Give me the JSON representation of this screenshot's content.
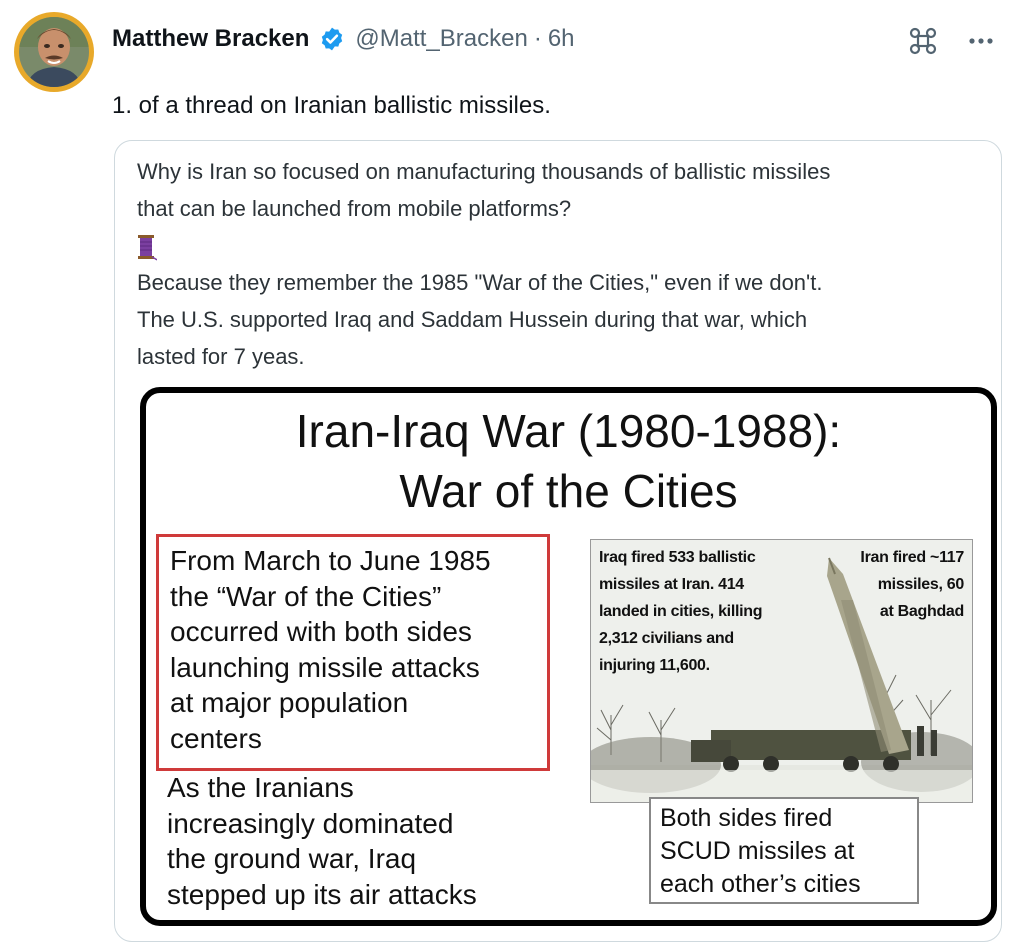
{
  "tweet": {
    "author_name": "Matthew Bracken",
    "handle": "@Matt_Bracken",
    "separator": "·",
    "time": "6h",
    "text": "1. of a thread on Iranian ballistic missiles.",
    "more_icon": "more-horizontal-icon",
    "cmd_icon": "command-icon"
  },
  "quote": {
    "para1_line1": "Why is Iran so focused on manufacturing thousands of ballistic missiles",
    "para1_line2": "that can be launched from mobile platforms?",
    "emoji": "thread-spool-emoji",
    "para2_line1": "Because they remember the 1985 \"War of the Cities,\" even if we don't.",
    "para2_line2": "The U.S. supported Iraq and Saddam Hussein during that war, which",
    "para2_line3": "lasted for 7 yeas."
  },
  "slide": {
    "title_line1": "Iran-Iraq War (1980-1988):",
    "title_line2": "War of the Cities",
    "redbox_text": "From March to June 1985\nthe “War of the Cities”\noccurred with both sides\nlaunching missile attacks\nat major population\ncenters",
    "after_text": "As the Iranians\nincreasingly dominated\nthe ground war, Iraq\nstepped up its air attacks",
    "photo_left": "Iraq fired 533 ballistic\nmissiles at Iran. 414\nlanded in cities, killing\n2,312 civilians and\ninjuring 11,600.",
    "photo_right": "Iran fired ~117\nmissiles, 60\nat Baghdad",
    "both_sides": "Both sides fired\nSCUD missiles at\neach other’s cities"
  },
  "colors": {
    "verified_blue": "#1d9bf0",
    "avatar_ring": "#e8a92a",
    "red_box": "#cf3a3a",
    "muted_text": "#536471"
  }
}
